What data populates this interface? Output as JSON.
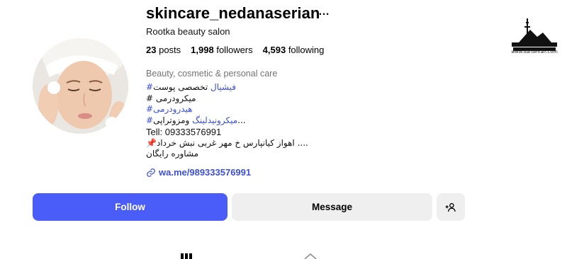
{
  "profile": {
    "username": "skincare_nedanaserian",
    "more_icon": "…",
    "full_name": "Rootka beauty salon",
    "stats": {
      "posts_count": "23",
      "posts_label": "posts",
      "followers_count": "1,998",
      "followers_label": "followers",
      "following_count": "4,593",
      "following_label": "following"
    },
    "category": "Beauty, cosmetic & personal care",
    "bio": {
      "line1_tag": "#فیشیال",
      "line1_text": " تخصصی پوست",
      "line2_text": "# میکرودرمی",
      "line3_tag": "#هیدرودرمی",
      "line4_tag": "#میکرونیدلینگ",
      "line4_text": " ومزوتراپی...",
      "line5": "Tell: 09333576991",
      "line6_icon": "📌",
      "line6_text": "اهواز کیانپارس خ مهر غربی نبش خرداد ....",
      "line7": "مشاوره رایگان"
    },
    "link": "wa.me/989333576991",
    "link_icon": "link-icon"
  },
  "actions": {
    "follow_label": "Follow",
    "message_label": "Message",
    "add_user_icon": "add-user-icon"
  },
  "watermark": {
    "caption": "www.dartehran.com"
  },
  "colors": {
    "accent": "#4a5df9",
    "link": "#3b4fd8",
    "secondary_button": "#efefef",
    "muted_text": "#737373"
  }
}
